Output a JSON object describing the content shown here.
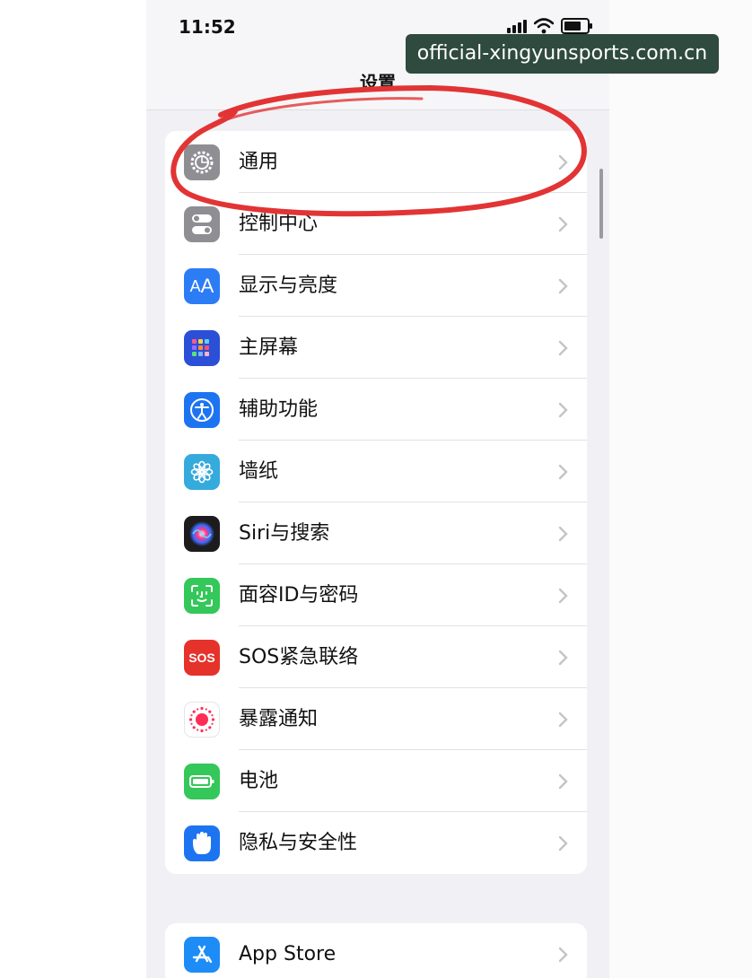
{
  "status_bar": {
    "time": "11:52"
  },
  "header": {
    "title": "设置"
  },
  "watermark": {
    "text": "official-xingyunsports.com.cn"
  },
  "group1": {
    "items": [
      {
        "label": "通用",
        "icon": "gear-icon",
        "color": "#8e8e93"
      },
      {
        "label": "控制中心",
        "icon": "toggles-icon",
        "color": "#8e8e93"
      },
      {
        "label": "显示与亮度",
        "icon": "text-size-icon",
        "color": "#2c7cf6"
      },
      {
        "label": "主屏幕",
        "icon": "app-grid-icon",
        "color": "#2b4fd6"
      },
      {
        "label": "辅助功能",
        "icon": "accessibility-icon",
        "color": "#1d74f0"
      },
      {
        "label": "墙纸",
        "icon": "flower-icon",
        "color": "#35aadc"
      },
      {
        "label": "Siri与搜索",
        "icon": "siri-icon",
        "color": "#1c1c1e"
      },
      {
        "label": "面容ID与密码",
        "icon": "face-id-icon",
        "color": "#34c759"
      },
      {
        "label": "SOS紧急联络",
        "icon": "sos-icon",
        "color": "#e5322b",
        "icon_text": "SOS"
      },
      {
        "label": "暴露通知",
        "icon": "exposure-notification-icon",
        "color": "#ffffff"
      },
      {
        "label": "电池",
        "icon": "battery-icon",
        "color": "#34c759"
      },
      {
        "label": "隐私与安全性",
        "icon": "hand-icon",
        "color": "#1d74f0"
      }
    ]
  },
  "group2": {
    "items": [
      {
        "label": "App Store",
        "icon": "app-store-icon",
        "color": "#1d8cf6"
      }
    ]
  },
  "annotation": {
    "color": "#e23434"
  }
}
